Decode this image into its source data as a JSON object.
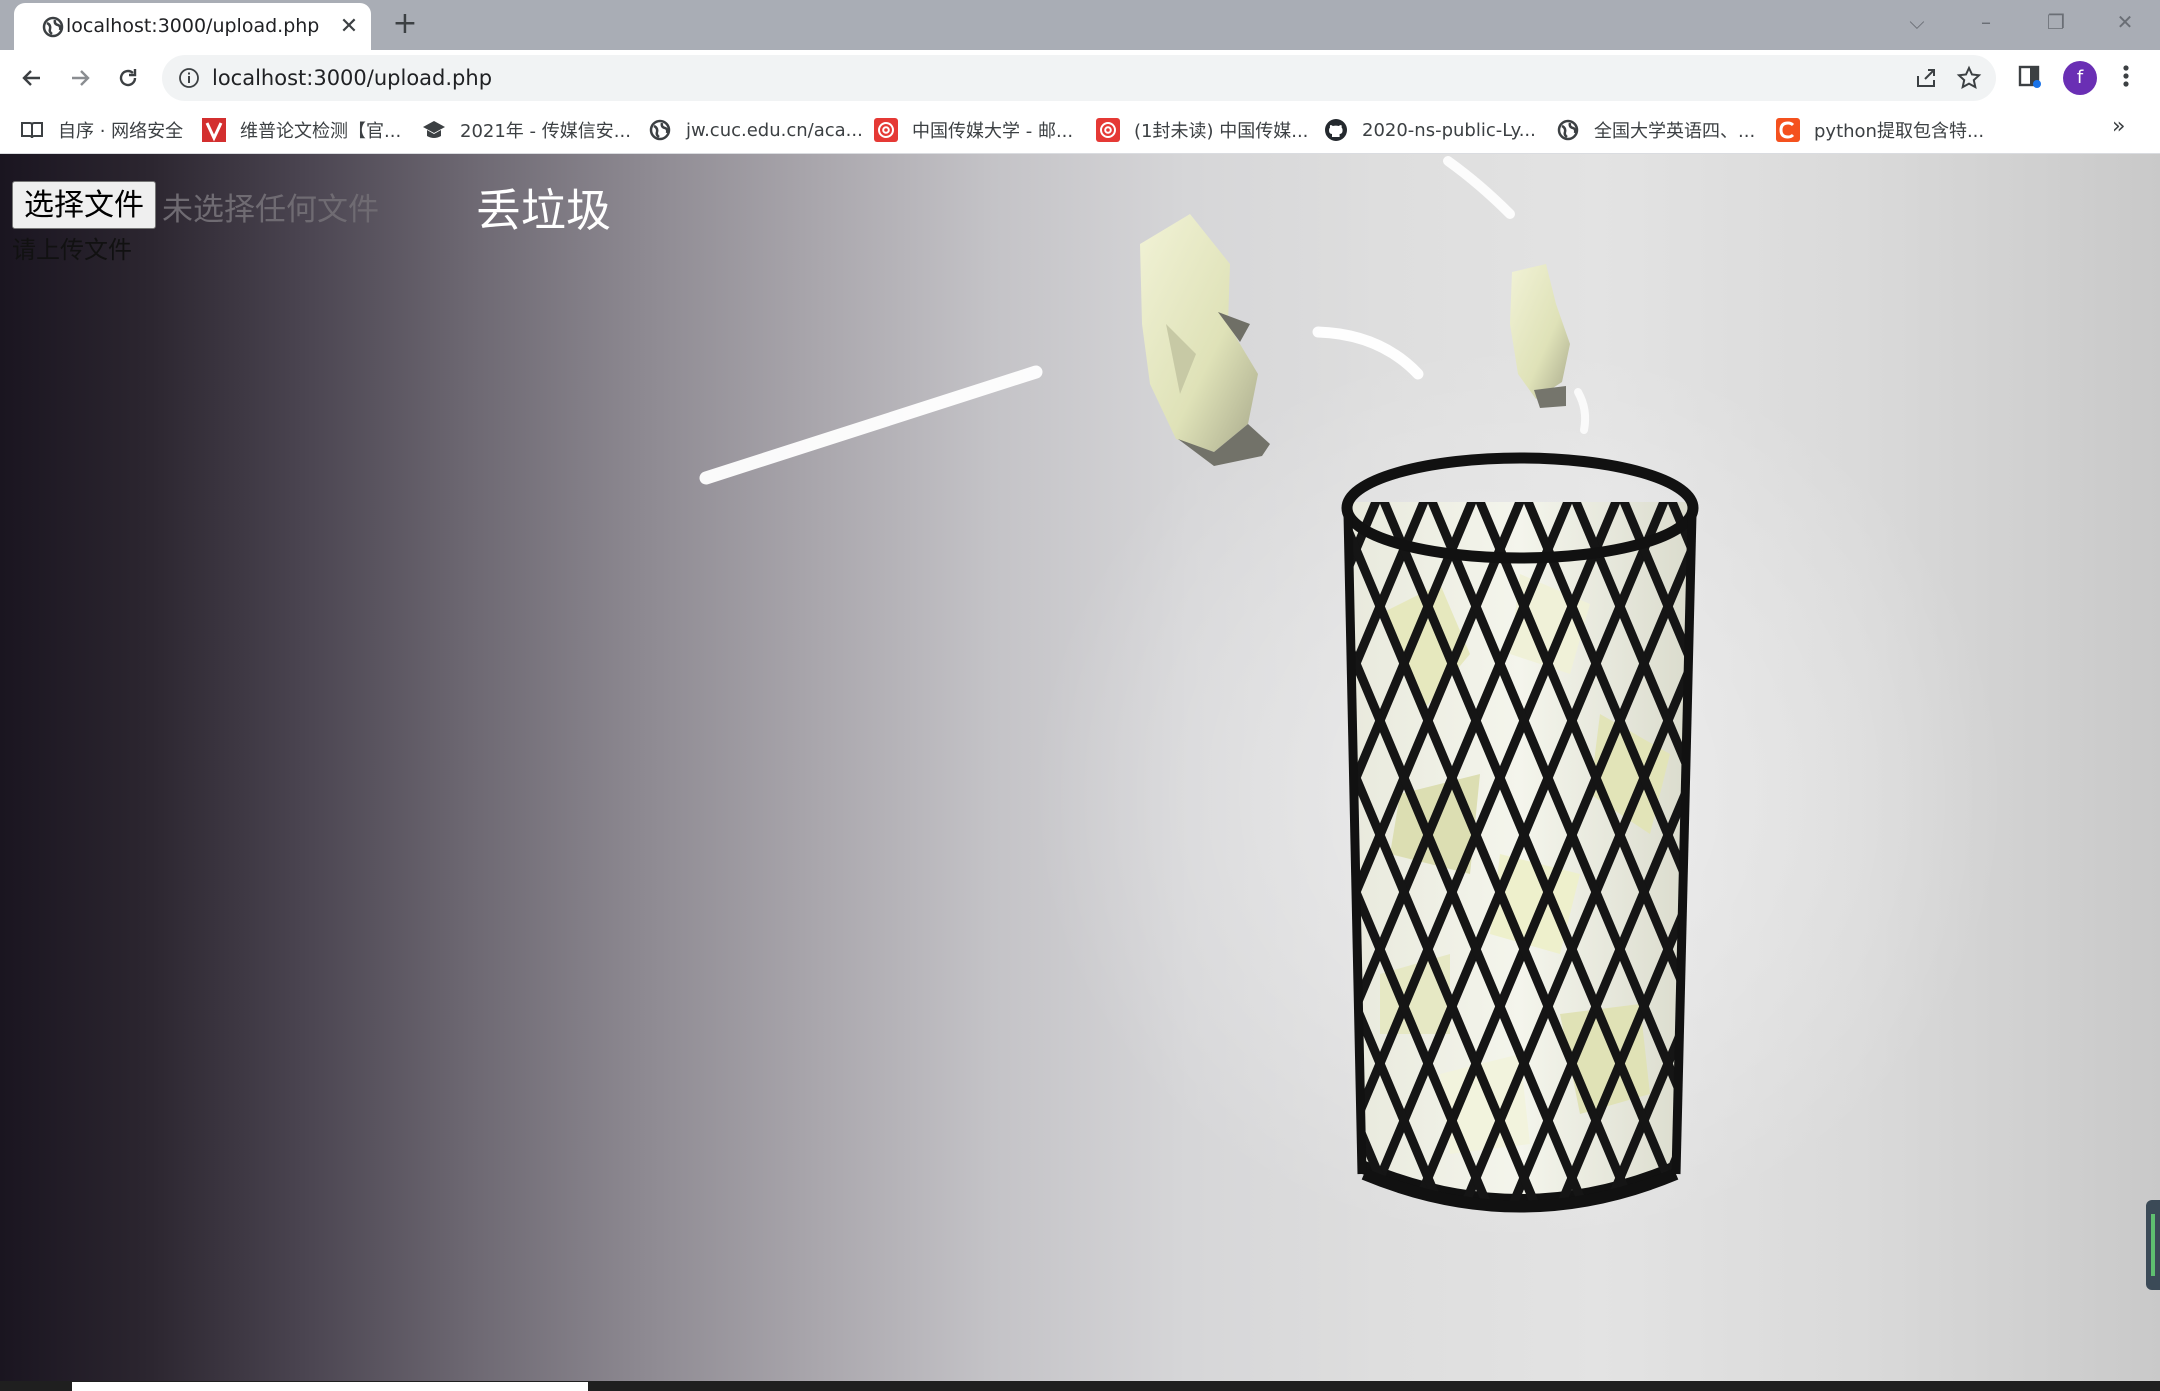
{
  "browser": {
    "tab": {
      "title": "localhost:3000/upload.php",
      "close": "✕"
    },
    "new_tab": "+",
    "window_controls": {
      "menu": "⌵",
      "minimize": "–",
      "restore": "❐",
      "close": "✕"
    },
    "url": "localhost:3000/upload.php",
    "profile_initial": "f",
    "bookmarks": [
      {
        "label": "自序 · 网络安全",
        "icon": "book-icon"
      },
      {
        "label": "维普论文检测【官...",
        "icon": "vip-icon"
      },
      {
        "label": "2021年 - 传媒信安...",
        "icon": "graduation-cap-icon"
      },
      {
        "label": "jw.cuc.edu.cn/aca...",
        "icon": "globe-icon"
      },
      {
        "label": "中国传媒大学 - 邮...",
        "icon": "mail-at-icon"
      },
      {
        "label": "(1封未读) 中国传媒...",
        "icon": "mail-at-icon"
      },
      {
        "label": "2020-ns-public-Ly...",
        "icon": "github-icon"
      },
      {
        "label": "全国大学英语四、...",
        "icon": "globe-icon"
      },
      {
        "label": "python提取包含特...",
        "icon": "csdn-icon"
      }
    ],
    "bookmarks_overflow": "»"
  },
  "page": {
    "file_button_label": "选择文件",
    "file_status": "未选择任何文件",
    "submit_label": "丢垃圾",
    "hint": "请上传文件"
  },
  "colors": {
    "accent_avatar": "#6a2fb4",
    "bookmark_red": "#e53935"
  }
}
